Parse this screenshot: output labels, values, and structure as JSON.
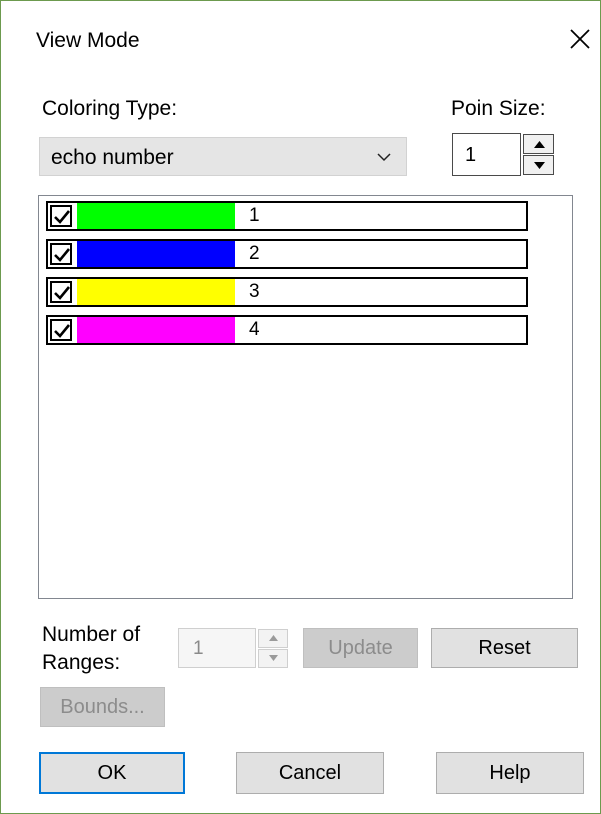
{
  "dialog": {
    "title": "View Mode",
    "close_icon": "close-icon"
  },
  "coloring": {
    "label": "Coloring Type:",
    "selected": "echo number"
  },
  "point_size": {
    "label": "Poin Size:",
    "value": "1"
  },
  "list": {
    "items": [
      {
        "label": "1",
        "checked": true,
        "color": "#00ff00"
      },
      {
        "label": "2",
        "checked": true,
        "color": "#0000ff"
      },
      {
        "label": "3",
        "checked": true,
        "color": "#ffff00"
      },
      {
        "label": "4",
        "checked": true,
        "color": "#ff00ff"
      }
    ]
  },
  "ranges": {
    "label_line1": "Number of",
    "label_line2": "Ranges:",
    "value": "1"
  },
  "buttons": {
    "update": "Update",
    "reset": "Reset",
    "bounds": "Bounds...",
    "ok": "OK",
    "cancel": "Cancel",
    "help": "Help"
  }
}
